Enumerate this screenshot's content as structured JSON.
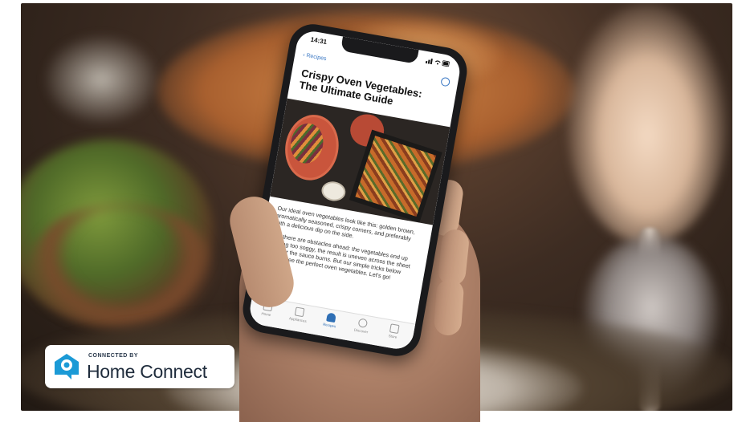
{
  "phone": {
    "status_time": "14:31",
    "back_label": "Recipes",
    "title": "Crispy Oven Vegetables: The Ultimate Guide",
    "paragraph_1": "Our ideal oven vegetables look like this: golden brown, aromatically seasoned, crispy corners, and preferably with a delicious dip on the side.",
    "paragraph_2": "But there are obstacles ahead: the vegetables end up getting too soggy, the result is uneven across the sheet pan, or the sauce burns. But our simple tricks below guarantee the perfect oven vegetables. Let's go!",
    "tabs": [
      {
        "label": "Home"
      },
      {
        "label": "Appliances"
      },
      {
        "label": "Recipes"
      },
      {
        "label": "Discover"
      },
      {
        "label": "Store"
      }
    ]
  },
  "badge": {
    "connected_by": "CONNECTED BY",
    "brand": "Home Connect"
  },
  "colors": {
    "accent_blue": "#2f6fb5",
    "brand_navy": "#1f2c3c",
    "logo_blue": "#1b9ad6"
  }
}
